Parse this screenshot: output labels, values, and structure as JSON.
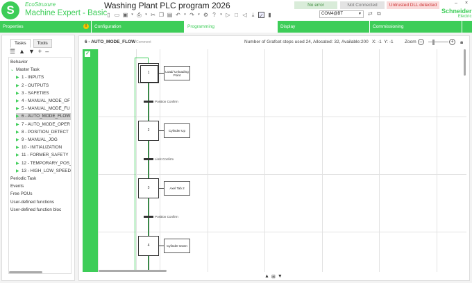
{
  "app": {
    "brand": "EcoStruxure",
    "name": "Machine Expert - Basic",
    "title": "Washing Plant PLC program 2026",
    "logo_letter": "S"
  },
  "status": {
    "error": "No error",
    "connection": "Not Connected",
    "dll": "Untrusted DLL detected"
  },
  "window_controls": {
    "minimize": "–",
    "close": "×"
  },
  "vendor": {
    "name": "Schneider",
    "sub": "Electric"
  },
  "toolbar": {
    "com_port": "COM4@BT"
  },
  "nav": {
    "properties": "Properties",
    "configuration": "Configuration",
    "programming": "Programming",
    "display": "Display",
    "commissioning": "Commissioning",
    "warn_symbol": "!"
  },
  "left_pane": {
    "tabs": [
      "Tasks",
      "Tools"
    ],
    "tree": [
      {
        "label": "Behavior",
        "indent": 0,
        "expander": ""
      },
      {
        "label": "Master Task",
        "indent": 0,
        "expander": "down"
      },
      {
        "label": "1 - INPUTS",
        "indent": 1,
        "expander": "right"
      },
      {
        "label": "2 - OUTPUTS",
        "indent": 1,
        "expander": "right"
      },
      {
        "label": "3 - SAFETIES",
        "indent": 1,
        "expander": "right"
      },
      {
        "label": "4 - MANUAL_MODE_OF",
        "indent": 1,
        "expander": "right"
      },
      {
        "label": "5 - MANUAL_MODE_FU",
        "indent": 1,
        "expander": "right"
      },
      {
        "label": "6 - AUTO_MODE_FLOW",
        "indent": 1,
        "expander": "right",
        "selected": true
      },
      {
        "label": "7 - AUTO_MODE_OPER",
        "indent": 1,
        "expander": "right"
      },
      {
        "label": "8 - POSITION_DETECT",
        "indent": 1,
        "expander": "right"
      },
      {
        "label": "9 - MANUAL_JOG",
        "indent": 1,
        "expander": "right"
      },
      {
        "label": "10 - INITIALIZATION",
        "indent": 1,
        "expander": "right"
      },
      {
        "label": "11 - FORMER_SAFETY",
        "indent": 1,
        "expander": "right"
      },
      {
        "label": "12 - TEMPORARY_POS_",
        "indent": 1,
        "expander": "right"
      },
      {
        "label": "13 - HIGH_LOW_SPEED",
        "indent": 1,
        "expander": "right"
      },
      {
        "label": "Periodic Task",
        "indent": 0,
        "expander": ""
      },
      {
        "label": "Events",
        "indent": 0,
        "expander": ""
      },
      {
        "label": "Free POUs",
        "indent": 0,
        "expander": ""
      },
      {
        "label": "User-defined functions",
        "indent": 0,
        "expander": ""
      },
      {
        "label": "User-defined function bloc",
        "indent": 0,
        "expander": ""
      }
    ]
  },
  "editor": {
    "pou_name": "6 - AUTO_MODE_FLOW",
    "comment_label": "Comment",
    "stats": "Number of Grafcet steps used 24,  Allocated: 32,  Available:200",
    "x_label": "X:",
    "x_value": "-1",
    "y_label": "Y:",
    "y_value": "-1",
    "zoom_label": "Zoom"
  },
  "grafcet": {
    "steps": [
      {
        "number": "1",
        "initial": true,
        "action": "Load/ Unloading Point"
      },
      {
        "number": "2",
        "initial": false,
        "action": "Cylinder Up"
      },
      {
        "number": "3",
        "initial": false,
        "action": "Axel Tab 2"
      },
      {
        "number": "4",
        "initial": false,
        "action": "Cylinder Down"
      }
    ],
    "transitions": [
      "Position Confirm",
      "Limit Confirm",
      "Position Confirm"
    ]
  }
}
